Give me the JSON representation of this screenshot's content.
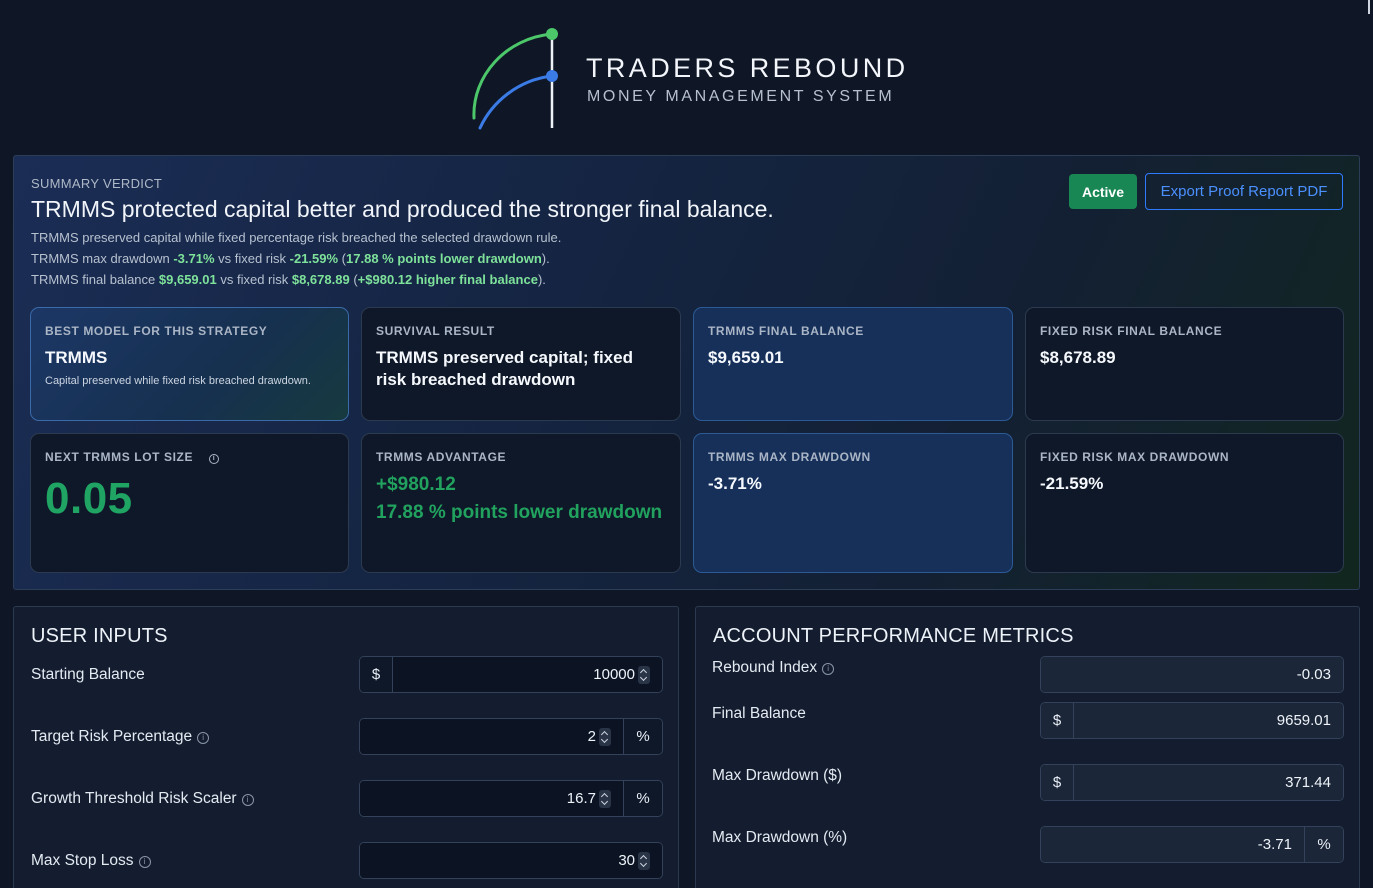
{
  "brand": {
    "title": "TRADERS REBOUND",
    "subtitle": "MONEY MANAGEMENT SYSTEM",
    "colors": {
      "arc_green": "#4cc76a",
      "arc_blue": "#3a7be6"
    }
  },
  "summary": {
    "label": "SUMMARY VERDICT",
    "headline": "TRMMS protected capital better and produced the stronger final balance.",
    "line1": "TRMMS preserved capital while fixed percentage risk breached the selected drawdown rule.",
    "line2": {
      "a": "TRMMS max drawdown ",
      "b": "-3.71%",
      "c": " vs fixed risk ",
      "d": "-21.59%",
      "e": " (",
      "f": "17.88 % points lower drawdown",
      "g": ")."
    },
    "line3": {
      "a": "TRMMS final balance ",
      "b": "$9,659.01",
      "c": " vs fixed risk ",
      "d": "$8,678.89",
      "e": " (",
      "f": "+$980.12 higher final balance",
      "g": ")."
    },
    "active_label": "Active",
    "export_label": "Export Proof Report PDF",
    "cards": {
      "best": {
        "label": "BEST MODEL FOR THIS STRATEGY",
        "value": "TRMMS",
        "note": "Capital preserved while fixed risk breached drawdown."
      },
      "survival": {
        "label": "SURVIVAL RESULT",
        "value": "TRMMS preserved capital; fixed risk breached drawdown"
      },
      "trmms_final": {
        "label": "TRMMS FINAL BALANCE",
        "value": "$9,659.01"
      },
      "fixed_final": {
        "label": "FIXED RISK FINAL BALANCE",
        "value": "$8,678.89"
      },
      "next_lot": {
        "label": "NEXT TRMMS LOT SIZE",
        "value": "0.05"
      },
      "advantage": {
        "label": "TRMMS ADVANTAGE",
        "line1": "+$980.12",
        "line2": "17.88 % points lower drawdown"
      },
      "trmms_dd": {
        "label": "TRMMS MAX DRAWDOWN",
        "value": "-3.71%"
      },
      "fixed_dd": {
        "label": "FIXED RISK MAX DRAWDOWN",
        "value": "-21.59%"
      }
    }
  },
  "inputs": {
    "title": "USER INPUTS",
    "starting_balance": {
      "label": "Starting Balance",
      "prefix": "$",
      "value": "10000"
    },
    "target_risk": {
      "label": "Target Risk Percentage",
      "value": "2",
      "suffix": "%"
    },
    "growth_scaler": {
      "label": "Growth Threshold Risk Scaler",
      "value": "16.7",
      "suffix": "%"
    },
    "max_stop_loss": {
      "label": "Max Stop Loss",
      "value": "30"
    }
  },
  "metrics": {
    "title": "ACCOUNT PERFORMANCE METRICS",
    "rebound_index": {
      "label": "Rebound Index",
      "value": "-0.03"
    },
    "final_balance": {
      "label": "Final Balance",
      "prefix": "$",
      "value": "9659.01"
    },
    "max_dd_dollar": {
      "label": "Max Drawdown ($)",
      "prefix": "$",
      "value": "371.44"
    },
    "max_dd_pct": {
      "label": "Max Drawdown (%)",
      "value": "-3.71",
      "suffix": "%"
    }
  }
}
